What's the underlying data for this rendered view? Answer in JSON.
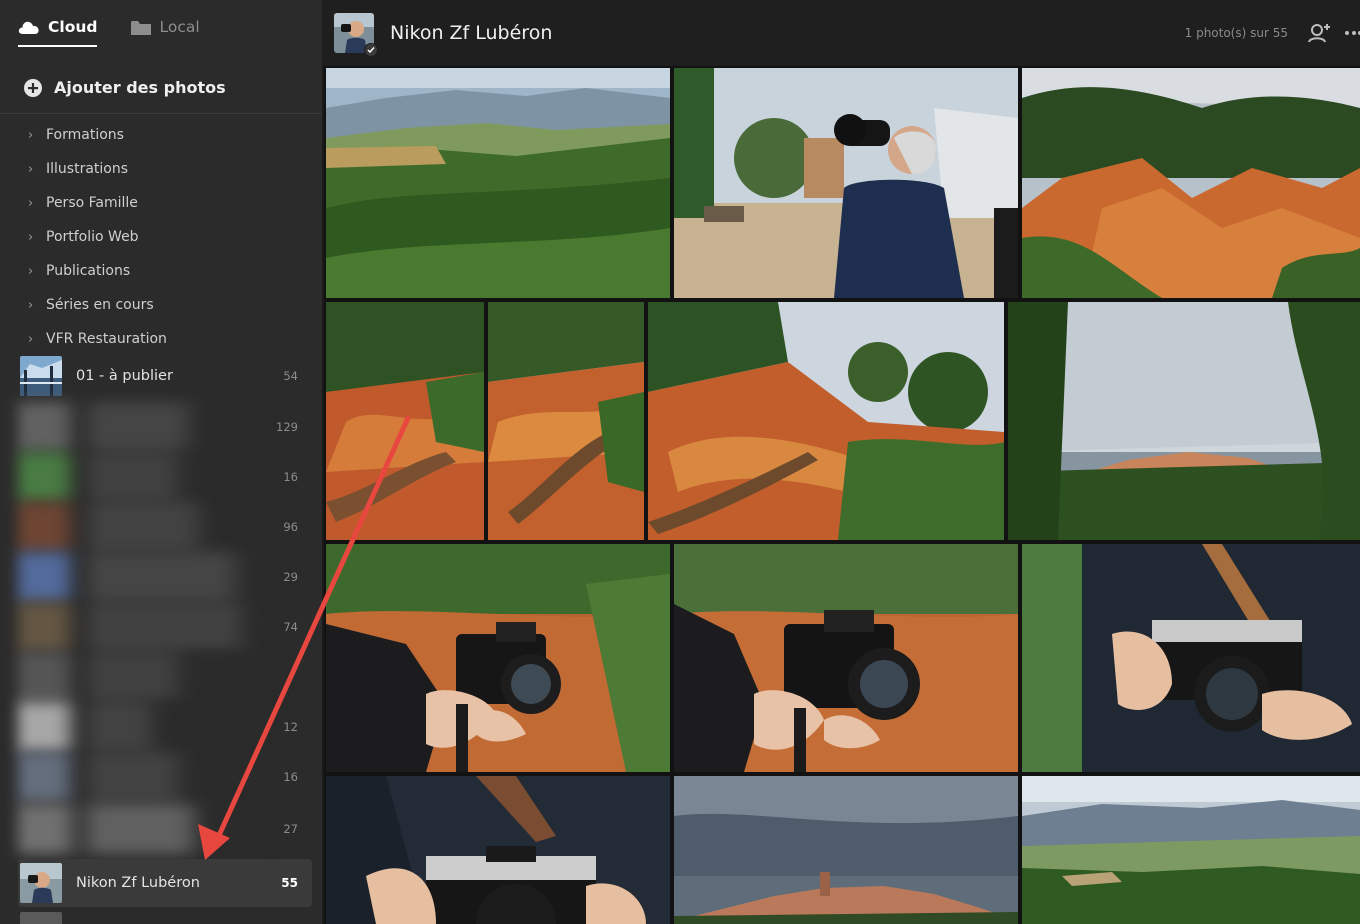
{
  "sidebar": {
    "tabs": [
      {
        "label": "Cloud",
        "icon": "cloud-icon",
        "active": true
      },
      {
        "label": "Local",
        "icon": "folder-icon",
        "active": false
      }
    ],
    "add_photos_label": "Ajouter des photos",
    "folders": [
      {
        "label": "Formations"
      },
      {
        "label": "Illustrations"
      },
      {
        "label": "Perso Famille"
      },
      {
        "label": "Portfolio Web"
      },
      {
        "label": "Publications"
      },
      {
        "label": "Séries en cours"
      },
      {
        "label": "VFR Restauration"
      }
    ],
    "album_first": {
      "name": "01 - à publier",
      "count": "54"
    },
    "blurred_counts": [
      "129",
      "16",
      "96",
      "29",
      "74",
      "",
      "12",
      "16",
      "27"
    ],
    "album_selected": {
      "name": "Nikon Zf Lubéron",
      "count": "55"
    }
  },
  "header": {
    "title": "Nikon Zf Lubéron",
    "photo_count": "1 photo(s) sur 55",
    "icons": [
      "add-person-icon",
      "more-icon"
    ]
  },
  "annotation": {
    "color": "#e8473f"
  }
}
